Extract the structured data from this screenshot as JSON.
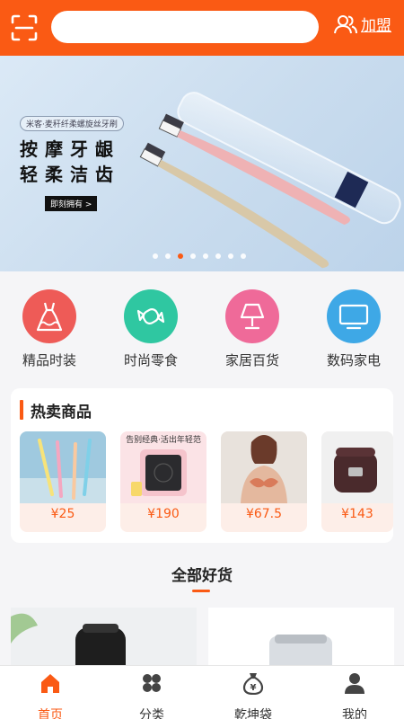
{
  "header": {
    "search_placeholder": "",
    "join_label": "加盟",
    "accent": "#fa5a14"
  },
  "banner": {
    "tag": "米客·麦秆纤柔螺旋丝牙刷",
    "line1": "按摩牙龈",
    "line2": "轻柔洁齿",
    "button": "即刻拥有 >",
    "page_count": 8,
    "active_page": 3
  },
  "categories": [
    {
      "label": "精品时装",
      "icon": "dress-icon",
      "color": "#ee5b57"
    },
    {
      "label": "时尚零食",
      "icon": "candy-icon",
      "color": "#2fc7a1"
    },
    {
      "label": "家居百货",
      "icon": "lamp-icon",
      "color": "#ef6a99"
    },
    {
      "label": "数码家电",
      "icon": "monitor-icon",
      "color": "#3ea8e6"
    }
  ],
  "hot": {
    "title": "热卖商品",
    "items": [
      {
        "price": "¥25",
        "icon": "toothbrush-product"
      },
      {
        "price": "¥190",
        "icon": "cooker-product",
        "promo": "告别经典·活出年轻范"
      },
      {
        "price": "¥67.5",
        "icon": "lingerie-product"
      },
      {
        "price": "¥143",
        "icon": "rice-cooker-product"
      }
    ]
  },
  "all_goods": {
    "title": "全部好货"
  },
  "tabbar": [
    {
      "label": "首页",
      "icon": "home-icon",
      "active": true
    },
    {
      "label": "分类",
      "icon": "category-icon",
      "active": false
    },
    {
      "label": "乾坤袋",
      "icon": "money-bag-icon",
      "active": false
    },
    {
      "label": "我的",
      "icon": "user-icon",
      "active": false
    }
  ]
}
